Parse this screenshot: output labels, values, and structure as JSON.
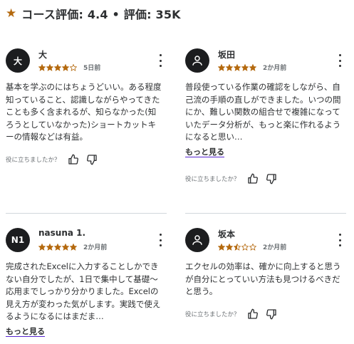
{
  "header": {
    "title": "コース評価: 4.4 • 評価: 35K",
    "accent": "#b4690e"
  },
  "helpful_question": "役に立ちましたか？",
  "more_label": "もっと見る",
  "reviews": [
    {
      "initials": "大",
      "name": "大",
      "rating": 4,
      "date": "5日前",
      "text": "基本を学ぶのにはちょうどいい。ある程度知っていること、認識しながらやってきたことも多く含まれるが、知らなかった(知ろうとしていなかった)ショートカットキーの情報などは有益。"
    },
    {
      "initials": "",
      "avatar_icon": "user-icon",
      "name": "坂田",
      "rating": 5,
      "date": "2か月前",
      "text": "普段使っている作業の確認をしながら、自己流の手順の直しができました。いつの間にか、難しい関数の組合せで複雑になっていたデータ分析が、もっと楽に作れるようになると思い…"
    },
    {
      "initials": "N1",
      "name": "nasuna 1.",
      "rating": 5,
      "date": "2か月前",
      "text": "完成されたExcelに入力することしかできない自分でしたが、1日で集中して基礎〜応用までしっかり分かりました。Excelの見え方が変わった気がします。実践で使えるようになるにはまだま…"
    },
    {
      "initials": "",
      "avatar_icon": "user-icon",
      "name": "坂本",
      "rating": 2.5,
      "date": "2か月前",
      "text": "エクセルの効率は、確かに向上すると思うが自分にとっていい方法も見つけるべきだと思う。"
    }
  ]
}
